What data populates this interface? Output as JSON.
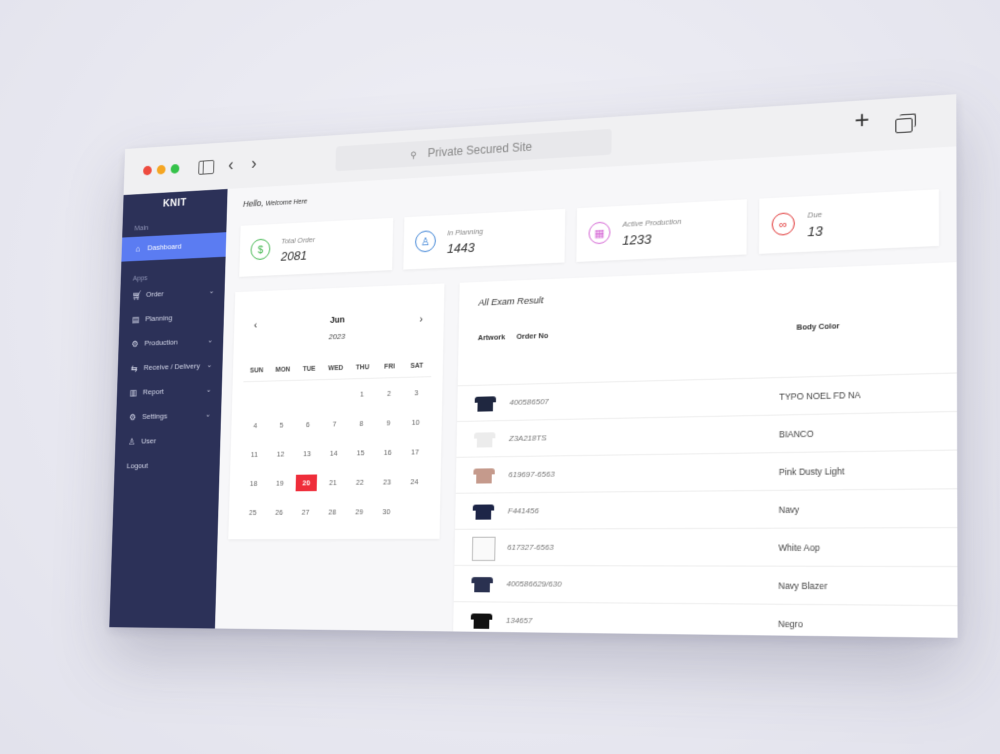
{
  "browser": {
    "address_text": "Private Secured Site"
  },
  "sidebar": {
    "brand": "KNIT",
    "section_main": "Main",
    "section_apps": "Apps",
    "items": [
      {
        "label": "Dashboard",
        "icon": "home-icon"
      },
      {
        "label": "Order",
        "icon": "cart-icon"
      },
      {
        "label": "Planning",
        "icon": "clipboard-icon"
      },
      {
        "label": "Production",
        "icon": "factory-icon"
      },
      {
        "label": "Receive / Delivery",
        "icon": "truck-icon"
      },
      {
        "label": "Report",
        "icon": "bar-chart-icon"
      },
      {
        "label": "Settings",
        "icon": "gear-icon"
      },
      {
        "label": "User",
        "icon": "user-icon"
      },
      {
        "label": "Logout",
        "icon": ""
      }
    ]
  },
  "header": {
    "hello": "Hello,",
    "welcome": "Welcome Here"
  },
  "stats": [
    {
      "label": "Total Order",
      "value": "2081",
      "color": "#3cb54a",
      "icon": "dollar-icon"
    },
    {
      "label": "In Planning",
      "value": "1443",
      "color": "#3b82d6",
      "icon": "person-icon"
    },
    {
      "label": "Active Production",
      "value": "1233",
      "color": "#d66ad6",
      "icon": "grid-icon"
    },
    {
      "label": "Due",
      "value": "13",
      "color": "#e23b3b",
      "icon": "link-icon"
    }
  ],
  "calendar": {
    "month": "Jun",
    "year": "2023",
    "weekdays": [
      "SUN",
      "MON",
      "TUE",
      "WED",
      "THU",
      "FRI",
      "SAT"
    ],
    "weeks": [
      [
        "",
        "",
        "",
        "",
        "1",
        "2",
        "3"
      ],
      [
        "4",
        "5",
        "6",
        "7",
        "8",
        "9",
        "10"
      ],
      [
        "11",
        "12",
        "13",
        "14",
        "15",
        "16",
        "17"
      ],
      [
        "18",
        "19",
        "20",
        "21",
        "22",
        "23",
        "24"
      ],
      [
        "25",
        "26",
        "27",
        "28",
        "29",
        "30",
        ""
      ]
    ],
    "today": "20",
    "today_color": "#ef2d3a"
  },
  "results": {
    "title": "All Exam Result",
    "columns": [
      "Artwork",
      "Order No",
      "Body Color"
    ],
    "rows": [
      {
        "order_no": "400586507",
        "body_color": "TYPO NOEL FD NA",
        "thumb_color": "#1f2740"
      },
      {
        "order_no": "Z3A218TS",
        "body_color": "BIANCO",
        "thumb_color": "#f2f2f2"
      },
      {
        "order_no": "619697-6563",
        "body_color": "Pink Dusty Light",
        "thumb_color": "#c59a8c"
      },
      {
        "order_no": "F441456",
        "body_color": "Navy",
        "thumb_color": "#1d2547"
      },
      {
        "order_no": "617327-6563",
        "body_color": "White Aop",
        "thumb_color": ""
      },
      {
        "order_no": "400586629/630",
        "body_color": "Navy Blazer",
        "thumb_color": "#2a3150"
      },
      {
        "order_no": "134657",
        "body_color": "Negro",
        "thumb_color": "#111111"
      }
    ]
  }
}
